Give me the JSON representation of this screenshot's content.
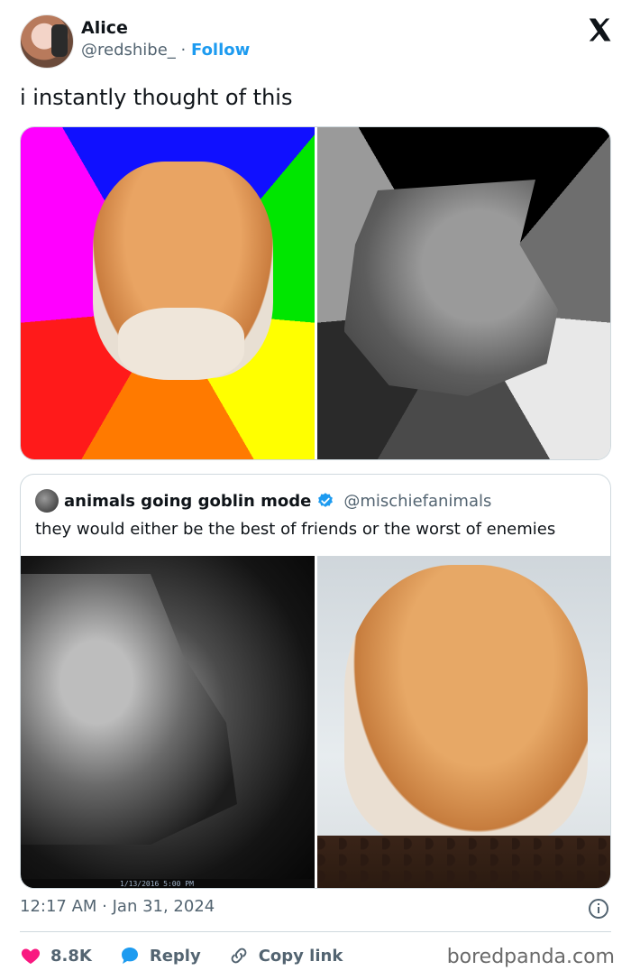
{
  "author": {
    "name": "Alice",
    "handle": "@redshibe_",
    "separator": "·",
    "follow_label": "Follow"
  },
  "tweet": {
    "text": "i instantly thought of this"
  },
  "quoted": {
    "name": "animals going goblin mode",
    "handle": "@mischiefanimals",
    "text": "they would either be the best of friends or the worst of enemies",
    "camera_stamp": "1/13/2016    5:00 PM"
  },
  "meta": {
    "timestamp": "12:17 AM · Jan 31, 2024"
  },
  "actions": {
    "like_count": "8.8K",
    "reply_label": "Reply",
    "copy_label": "Copy link"
  },
  "watermark": "boredpanda.com",
  "colors": {
    "accent": "#1d9bf0",
    "like": "#f91880",
    "text": "#0f1419",
    "muted": "#536471",
    "border": "#cfd9de"
  },
  "icons": [
    "x-logo-icon",
    "verified-icon",
    "info-icon",
    "heart-icon",
    "reply-bubble-icon",
    "link-icon"
  ]
}
